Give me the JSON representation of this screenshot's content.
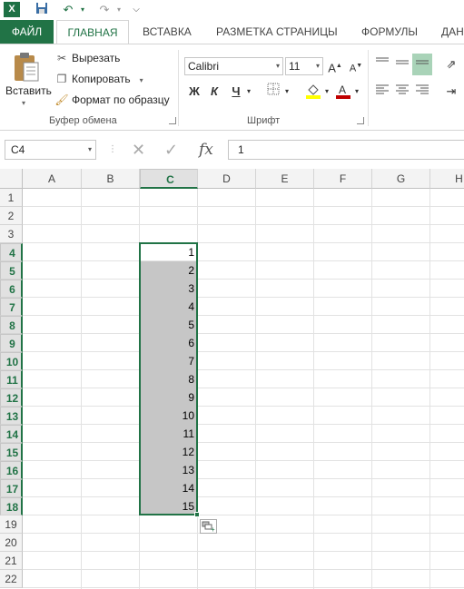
{
  "quick_access": {
    "logo": "X",
    "save_icon": "save-icon",
    "undo_icon": "undo-icon",
    "redo_icon": "redo-icon"
  },
  "tabs": [
    {
      "label": "ФАЙЛ"
    },
    {
      "label": "ГЛАВНАЯ"
    },
    {
      "label": "ВСТАВКА"
    },
    {
      "label": "РАЗМЕТКА СТРАНИЦЫ"
    },
    {
      "label": "ФОРМУЛЫ"
    },
    {
      "label": "ДАН"
    }
  ],
  "clipboard": {
    "paste_label": "Вставить",
    "cut_label": "Вырезать",
    "copy_label": "Копировать",
    "format_painter_label": "Формат по образцу",
    "group_label": "Буфер обмена"
  },
  "font": {
    "name": "Calibri",
    "size": "11",
    "bold": "Ж",
    "italic": "К",
    "underline": "Ч",
    "font_color": "#c00000",
    "fill_color": "#ffff00",
    "group_label": "Шрифт",
    "grow": "A",
    "shrink": "A"
  },
  "formula_bar": {
    "name_box": "C4",
    "fx": "fx",
    "value": "1"
  },
  "grid": {
    "columns": [
      "A",
      "B",
      "C",
      "D",
      "E",
      "F",
      "G",
      "H"
    ],
    "rows": [
      "1",
      "2",
      "3",
      "4",
      "5",
      "6",
      "7",
      "8",
      "9",
      "10",
      "11",
      "12",
      "13",
      "14",
      "15",
      "16",
      "17",
      "18",
      "19",
      "20",
      "21",
      "22"
    ],
    "selected_column": "C",
    "c_values": [
      "1",
      "2",
      "3",
      "4",
      "5",
      "6",
      "7",
      "8",
      "9",
      "10",
      "11",
      "12",
      "13",
      "14",
      "15"
    ],
    "selection_color": "#217346"
  }
}
